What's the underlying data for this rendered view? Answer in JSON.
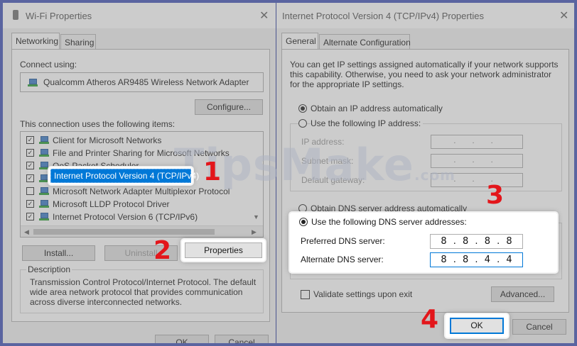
{
  "wifi_dialog": {
    "title": "Wi-Fi Properties",
    "close_glyph": "✕",
    "tabs": [
      "Networking",
      "Sharing"
    ],
    "connect_using_label": "Connect using:",
    "adapter_name": "Qualcomm Atheros AR9485 Wireless Network Adapter",
    "configure_label": "Configure...",
    "items_label": "This connection uses the following items:",
    "items": [
      {
        "label": "Client for Microsoft Networks",
        "checked": true,
        "icon": "network-client-icon"
      },
      {
        "label": "File and Printer Sharing for Microsoft Networks",
        "checked": true,
        "icon": "network-service-icon"
      },
      {
        "label": "QoS Packet Scheduler",
        "checked": true,
        "icon": "network-service-icon"
      },
      {
        "label": "Internet Protocol Version 4 (TCP/IPv4)",
        "checked": true,
        "icon": "network-protocol-icon",
        "selected": true
      },
      {
        "label": "Microsoft Network Adapter Multiplexor Protocol",
        "checked": false,
        "icon": "network-protocol-icon"
      },
      {
        "label": "Microsoft LLDP Protocol Driver",
        "checked": true,
        "icon": "network-protocol-icon"
      },
      {
        "label": "Internet Protocol Version 6 (TCP/IPv6)",
        "checked": true,
        "icon": "network-protocol-icon"
      }
    ],
    "install_label": "Install...",
    "uninstall_label": "Uninstall",
    "properties_label": "Properties",
    "description_label": "Description",
    "description_text": [
      "Transmission Control Protocol/Internet Protocol. The default",
      "wide area network protocol that provides communication",
      "across diverse interconnected networks."
    ],
    "ok_label": "OK",
    "cancel_label": "Cancel"
  },
  "ipv4_dialog": {
    "title": "Internet Protocol Version 4 (TCP/IPv4) Properties",
    "close_glyph": "✕",
    "tabs": [
      "General",
      "Alternate Configuration"
    ],
    "intro_text": [
      "You can get IP settings assigned automatically if your network supports",
      "this capability. Otherwise, you need to ask your network administrator",
      "for the appropriate IP settings."
    ],
    "obtain_ip_auto_label": "Obtain an IP address automatically",
    "use_following_ip_label": "Use the following IP address:",
    "ip_address_label": "IP address:",
    "subnet_mask_label": "Subnet mask:",
    "default_gateway_label": "Default gateway:",
    "empty_ip_dots": ". . .",
    "obtain_dns_auto_label": "Obtain DNS server address automatically",
    "use_following_dns_label": "Use the following DNS server addresses:",
    "preferred_dns_label": "Preferred DNS server:",
    "preferred_dns_value": "8 . 8 . 8 . 8",
    "alternate_dns_label": "Alternate DNS server:",
    "alternate_dns_value": "8 . 8 . 4 . 4",
    "validate_label": "Validate settings upon exit",
    "advanced_label": "Advanced...",
    "ok_label": "OK",
    "cancel_label": "Cancel"
  },
  "annotations": {
    "step1": "1",
    "step2": "2",
    "step3": "3",
    "step4": "4"
  },
  "watermark": {
    "text": "TipsMake",
    "suffix": ".com"
  },
  "colors": {
    "background": "#4b5590",
    "step_number": "#e3161b",
    "selection": "#0078d7"
  }
}
